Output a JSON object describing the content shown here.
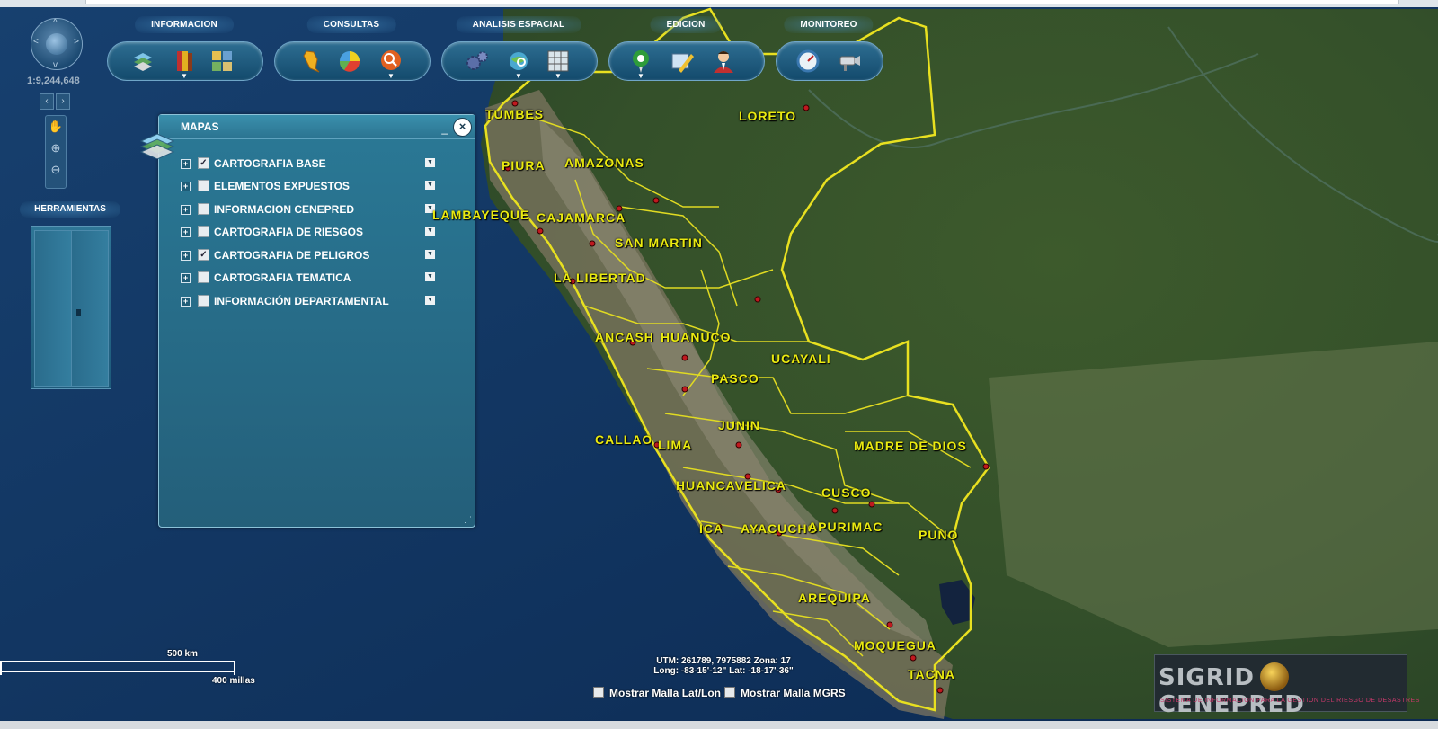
{
  "toolbar": {
    "groups": [
      {
        "title": "INFORMACION",
        "tools": [
          "layers-icon",
          "books-icon",
          "grid-maps-icon"
        ]
      },
      {
        "title": "CONSULTAS",
        "tools": [
          "peru-map-icon",
          "pie-chart-icon",
          "search-icon"
        ]
      },
      {
        "title": "ANALISIS ESPACIAL",
        "tools": [
          "gears-icon",
          "globe-search-icon",
          "grid-icon"
        ]
      },
      {
        "title": "EDICION",
        "tools": [
          "pin-icon",
          "note-edit-icon",
          "user-icon"
        ]
      },
      {
        "title": "MONITOREO",
        "tools": [
          "gauge-icon",
          "camera-icon"
        ]
      }
    ]
  },
  "nav": {
    "scale": "1:9,244,648",
    "tools_title": "HERRAMIENTAS"
  },
  "panel": {
    "title": "MAPAS",
    "minimize": "_",
    "close": "×",
    "layers": [
      {
        "label": "CARTOGRAFIA BASE",
        "checked": true
      },
      {
        "label": "ELEMENTOS EXPUESTOS",
        "checked": false
      },
      {
        "label": "INFORMACION CENEPRED",
        "checked": false
      },
      {
        "label": "CARTOGRAFIA DE RIESGOS",
        "checked": false
      },
      {
        "label": "CARTOGRAFIA DE PELIGROS",
        "checked": true
      },
      {
        "label": "CARTOGRAFIA TEMATICA",
        "checked": false
      },
      {
        "label": "INFORMACIÓN DEPARTAMENTAL",
        "checked": false
      }
    ]
  },
  "map": {
    "regions": [
      "TUMBES",
      "PIURA",
      "AMAZONAS",
      "LAMBAYEQUE",
      "CAJAMARCA",
      "LORETO",
      "SAN MARTIN",
      "LA LIBERTAD",
      "ANCASH",
      "HUANUCO",
      "UCAYALI",
      "PASCO",
      "JUNIN",
      "CALLAO",
      "LIMA",
      "MADRE DE DIOS",
      "HUANCAVELICA",
      "CUSCO",
      "ICA",
      "AYACUCHO",
      "APURIMAC",
      "PUNO",
      "AREQUIPA",
      "MOQUEGUA",
      "TACNA"
    ],
    "scalebar_km": "500 km",
    "scalebar_mi": "400 millas",
    "utm": "UTM: 261789, 7975882 Zona: 17",
    "latlon": "Long: -83-15'-12\"  Lat: -18-17'-36\"",
    "grid_latlon": "Mostrar Malla Lat/Lon",
    "grid_mgrs": "Mostrar Malla MGRS"
  },
  "logo": {
    "text_left": "SIGRID",
    "text_right": "CENEPRED",
    "subtitle": "SISTEMA DE INFORMACION PARA LA GESTION DEL RIESGO DE DESASTRES"
  },
  "colors": {
    "label": "#eaea10",
    "border": "#e8e020",
    "panel": "#2a7996"
  }
}
